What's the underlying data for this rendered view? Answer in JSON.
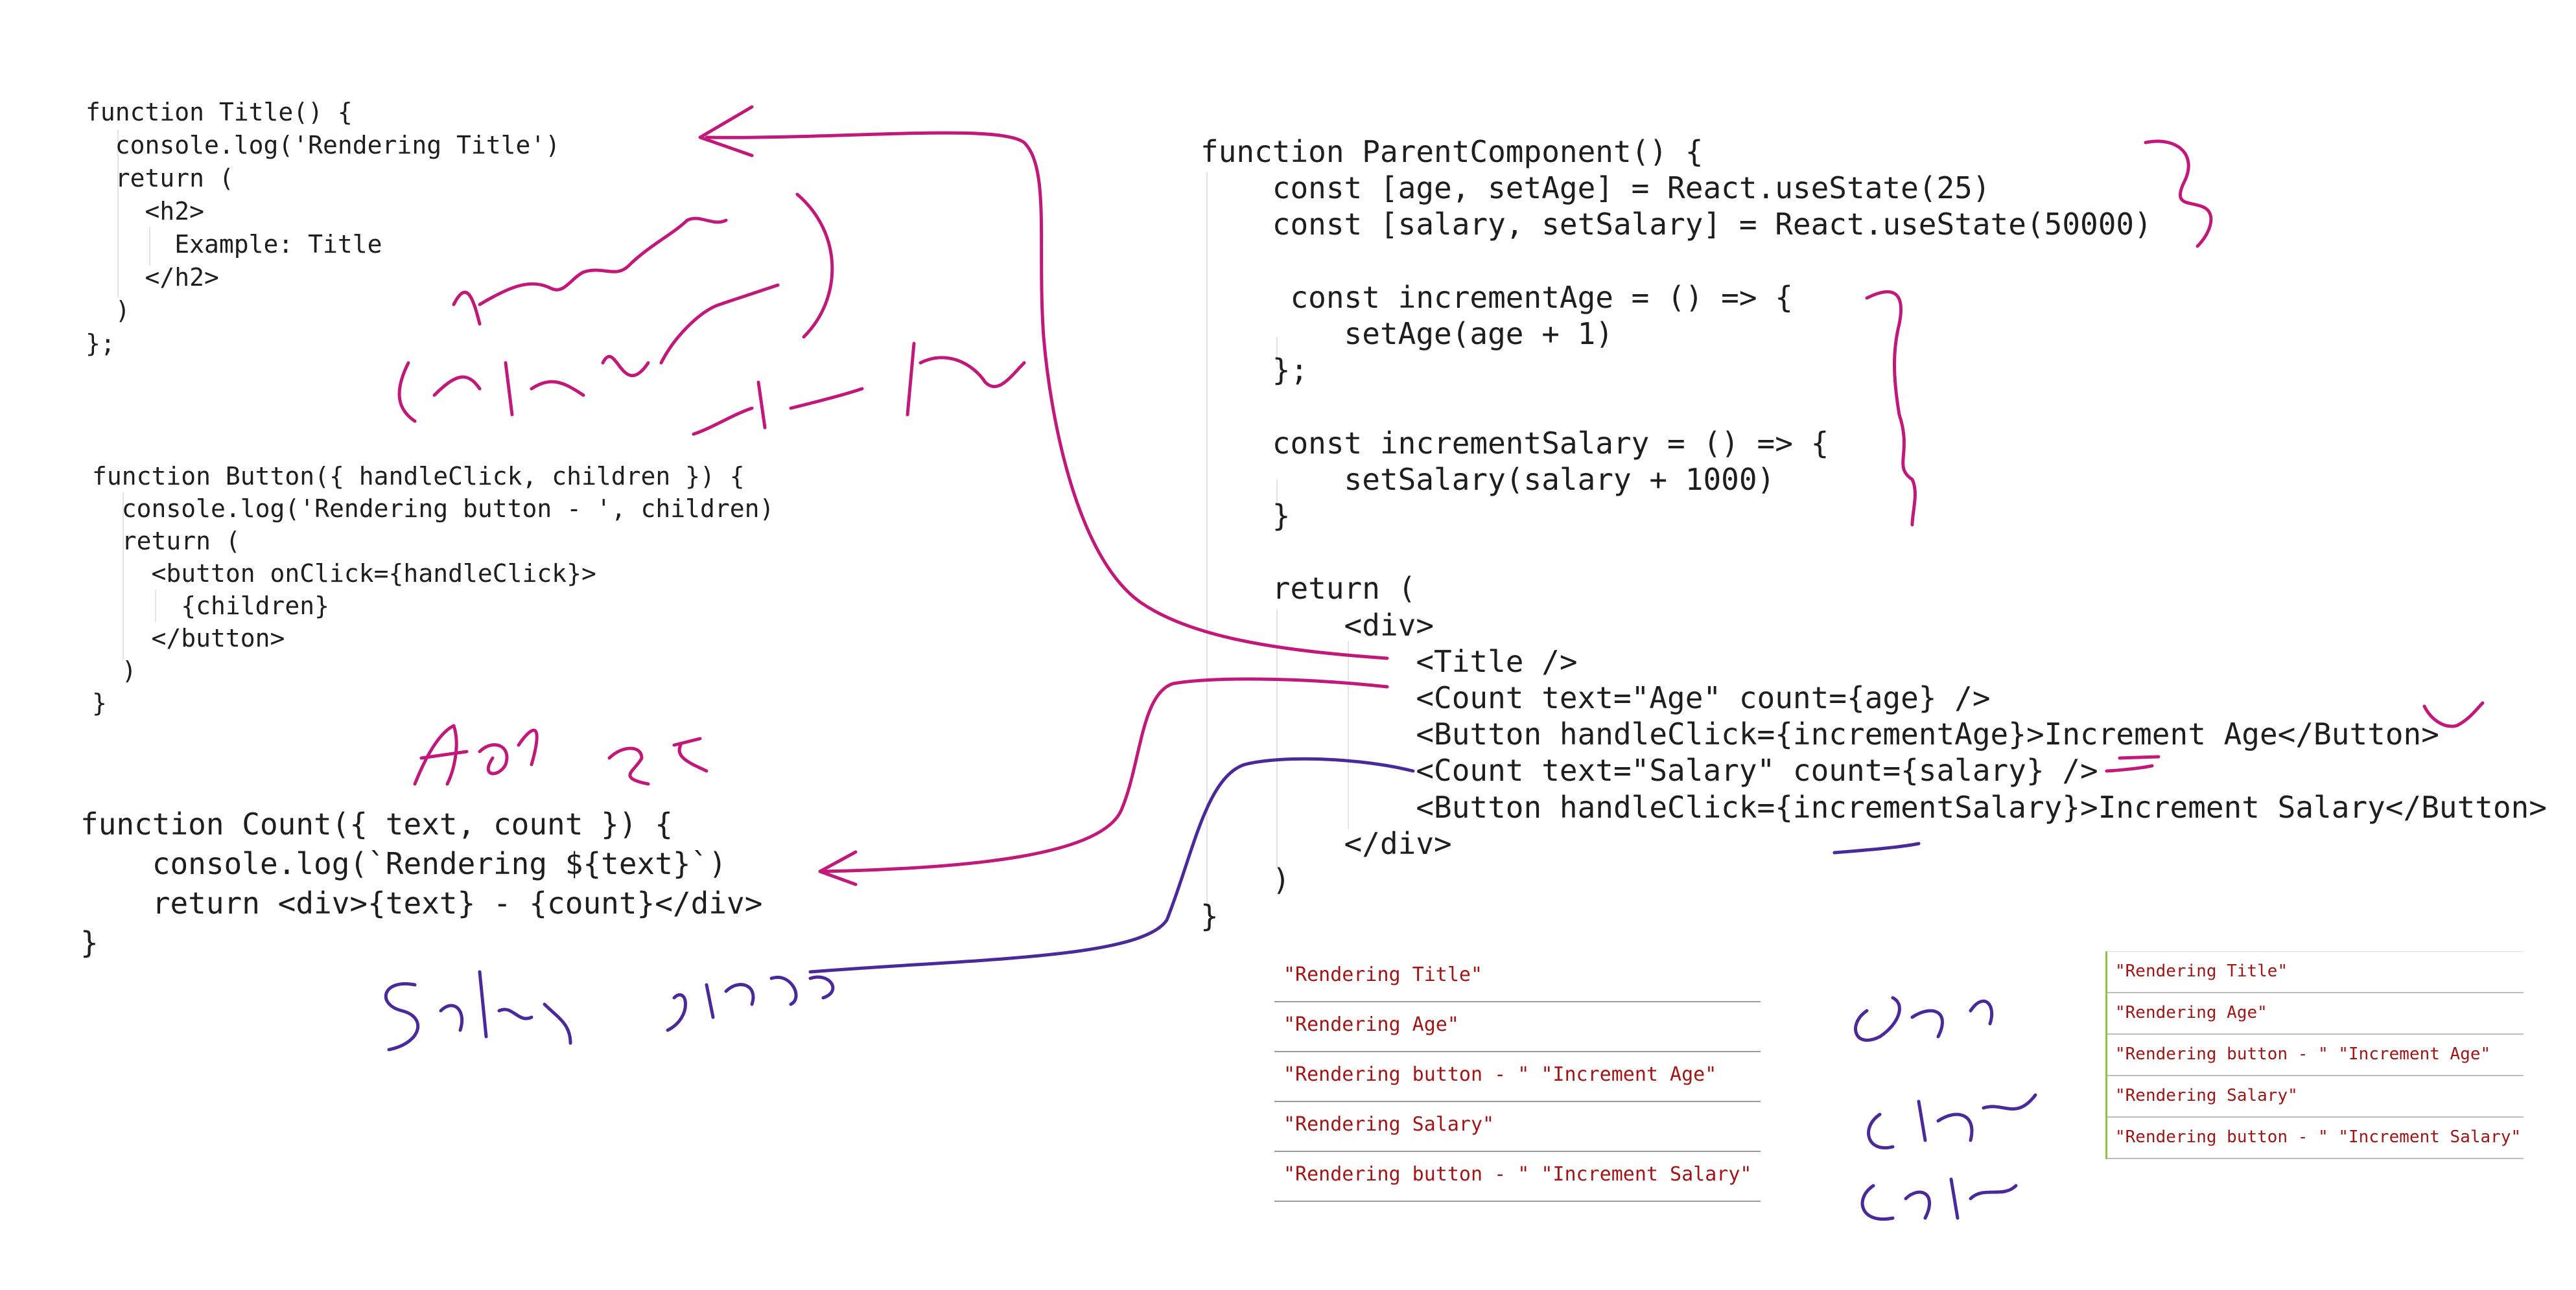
{
  "code": {
    "title_fn": [
      "function Title() {",
      "  console.log('Rendering Title')",
      "  return (",
      "    <h2>",
      "      Example: Title",
      "    </h2>",
      "  )",
      "};"
    ],
    "button_fn": [
      "function Button({ handleClick, children }) {",
      "  console.log('Rendering button - ', children)",
      "  return (",
      "    <button onClick={handleClick}>",
      "      {children}",
      "    </button>",
      "  )",
      "}"
    ],
    "count_fn": [
      "function Count({ text, count }) {",
      "    console.log(`Rendering ${text}`)",
      "    return <div>{text} - {count}</div>",
      "}"
    ],
    "parent_fn": [
      "function ParentComponent() {",
      "    const [age, setAge] = React.useState(25)",
      "    const [salary, setSalary] = React.useState(50000)",
      "",
      "     const incrementAge = () => {",
      "        setAge(age + 1)",
      "    };",
      "",
      "    const incrementSalary = () => {",
      "        setSalary(salary + 1000)",
      "    }",
      "",
      "    return (",
      "        <div>",
      "            <Title />",
      "            <Count text=\"Age\" count={age} />",
      "            <Button handleClick={incrementAge}>Increment Age</Button>",
      "            <Count text=\"Salary\" count={salary} />",
      "            <Button handleClick={incrementSalary}>Increment Salary</Button>",
      "        </div>",
      "    )",
      "}"
    ]
  },
  "console_left": [
    "\"Rendering Title\"",
    "\"Rendering Age\"",
    "\"Rendering button - \" \"Increment Age\"",
    "\"Rendering Salary\"",
    "\"Rendering button - \" \"Increment Salary\""
  ],
  "console_right": [
    "\"Rendering Title\"",
    "\"Rendering Age\"",
    "\"Rendering button - \" \"Increment Age\"",
    "\"Rendering Salary\"",
    "\"Rendering button - \" \"Increment Salary\""
  ],
  "colors": {
    "code_text": "#1e1e1e",
    "console_string": "#a31515",
    "ink_magenta": "#c2187a",
    "ink_purple": "#4a2a9a",
    "console_accent": "#8dc43c"
  }
}
